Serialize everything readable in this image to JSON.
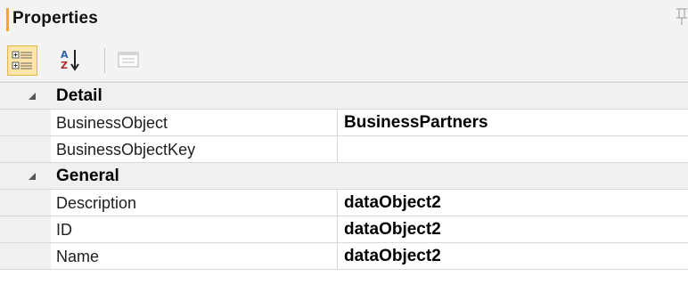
{
  "panel": {
    "title": "Properties",
    "accent_color": "#f4a91f",
    "pin_icon": "pin-icon"
  },
  "toolbar": {
    "buttons": [
      {
        "name": "categorized-view",
        "icon": "categorized-icon",
        "active": true
      },
      {
        "name": "alphabetical-sort",
        "icon": "sort-az-icon",
        "active": false
      },
      {
        "name": "property-pages",
        "icon": "property-pages-icon",
        "active": false
      }
    ]
  },
  "categories": [
    {
      "name": "Detail",
      "expanded": true,
      "properties": [
        {
          "name": "BusinessObject",
          "value": "BusinessPartners"
        },
        {
          "name": "BusinessObjectKey",
          "value": ""
        }
      ]
    },
    {
      "name": "General",
      "expanded": true,
      "properties": [
        {
          "name": "Description",
          "value": "dataObject2"
        },
        {
          "name": "ID",
          "value": "dataObject2"
        },
        {
          "name": "Name",
          "value": "dataObject2"
        }
      ]
    }
  ]
}
